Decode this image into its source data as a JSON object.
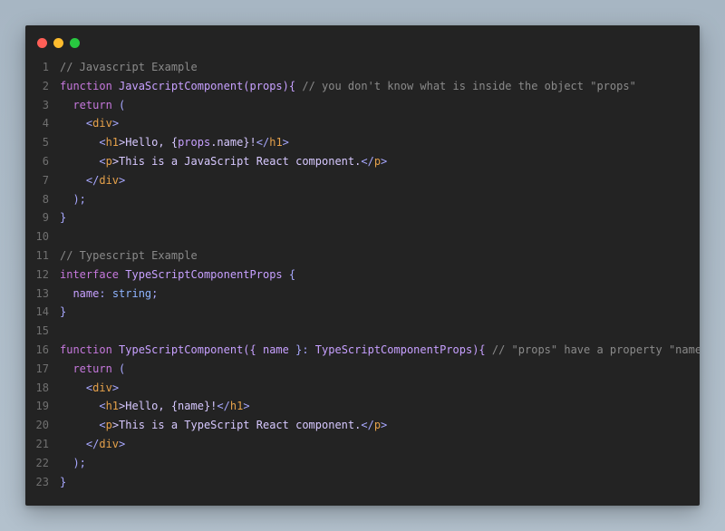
{
  "window": {
    "colors": {
      "background": "#232323",
      "traffic_red": "#ff5f57",
      "traffic_yellow": "#febc2e",
      "traffic_green": "#28c840"
    }
  },
  "code": {
    "line_numbers": [
      "1",
      "2",
      "3",
      "4",
      "5",
      "6",
      "7",
      "8",
      "9",
      "10",
      "11",
      "12",
      "13",
      "14",
      "15",
      "16",
      "17",
      "18",
      "19",
      "20",
      "21",
      "22",
      "23"
    ],
    "lines": [
      {
        "parts": [
          {
            "text": "// Javascript Example",
            "kind": "comment"
          }
        ]
      },
      {
        "parts": [
          {
            "text": "function",
            "kind": "kw"
          },
          {
            "text": " ",
            "kind": "plain"
          },
          {
            "text": "JavaScriptComponent(props){",
            "kind": "fn"
          },
          {
            "text": " ",
            "kind": "plain"
          },
          {
            "text": "// you don't know what is inside the object \"props\"",
            "kind": "comment"
          }
        ]
      },
      {
        "parts": [
          {
            "text": "  ",
            "kind": "plain"
          },
          {
            "text": "return",
            "kind": "kw"
          },
          {
            "text": " (",
            "kind": "punct"
          }
        ]
      },
      {
        "parts": [
          {
            "text": "    <",
            "kind": "punct"
          },
          {
            "text": "div",
            "kind": "tag"
          },
          {
            "text": ">",
            "kind": "punct"
          }
        ]
      },
      {
        "parts": [
          {
            "text": "      <",
            "kind": "punct"
          },
          {
            "text": "h1",
            "kind": "tag"
          },
          {
            "text": ">Hello, {",
            "kind": "jsx"
          },
          {
            "text": "props",
            "kind": "prop"
          },
          {
            "text": ".name}!",
            "kind": "jsx"
          },
          {
            "text": "</",
            "kind": "punct"
          },
          {
            "text": "h1",
            "kind": "tag"
          },
          {
            "text": ">",
            "kind": "punct"
          }
        ]
      },
      {
        "parts": [
          {
            "text": "      <",
            "kind": "punct"
          },
          {
            "text": "p",
            "kind": "tag"
          },
          {
            "text": ">This is a JavaScript React component.",
            "kind": "jsx"
          },
          {
            "text": "</",
            "kind": "punct"
          },
          {
            "text": "p",
            "kind": "tag"
          },
          {
            "text": ">",
            "kind": "punct"
          }
        ]
      },
      {
        "parts": [
          {
            "text": "    </",
            "kind": "punct"
          },
          {
            "text": "div",
            "kind": "tag"
          },
          {
            "text": ">",
            "kind": "punct"
          }
        ]
      },
      {
        "parts": [
          {
            "text": "  );",
            "kind": "punct"
          }
        ]
      },
      {
        "parts": [
          {
            "text": "}",
            "kind": "punct"
          }
        ]
      },
      {
        "parts": []
      },
      {
        "parts": [
          {
            "text": "// Typescript Example",
            "kind": "comment"
          }
        ]
      },
      {
        "parts": [
          {
            "text": "interface",
            "kind": "kw"
          },
          {
            "text": " ",
            "kind": "plain"
          },
          {
            "text": "TypeScriptComponentProps",
            "kind": "fn"
          },
          {
            "text": " {",
            "kind": "punct"
          }
        ]
      },
      {
        "parts": [
          {
            "text": "  ",
            "kind": "plain"
          },
          {
            "text": "name",
            "kind": "prop"
          },
          {
            "text": ": ",
            "kind": "punct"
          },
          {
            "text": "string",
            "kind": "type"
          },
          {
            "text": ";",
            "kind": "punct"
          }
        ]
      },
      {
        "parts": [
          {
            "text": "}",
            "kind": "punct"
          }
        ]
      },
      {
        "parts": []
      },
      {
        "parts": [
          {
            "text": "function",
            "kind": "kw"
          },
          {
            "text": " ",
            "kind": "plain"
          },
          {
            "text": "TypeScriptComponent({ ",
            "kind": "fn"
          },
          {
            "text": "name",
            "kind": "prop"
          },
          {
            "text": " }: ",
            "kind": "punct"
          },
          {
            "text": "TypeScriptComponentProps){",
            "kind": "fn"
          },
          {
            "text": " ",
            "kind": "plain"
          },
          {
            "text": "// \"props\" have a property \"name\"",
            "kind": "comment"
          }
        ]
      },
      {
        "parts": [
          {
            "text": "  ",
            "kind": "plain"
          },
          {
            "text": "return",
            "kind": "kw"
          },
          {
            "text": " (",
            "kind": "punct"
          }
        ]
      },
      {
        "parts": [
          {
            "text": "    <",
            "kind": "punct"
          },
          {
            "text": "div",
            "kind": "tag"
          },
          {
            "text": ">",
            "kind": "punct"
          }
        ]
      },
      {
        "parts": [
          {
            "text": "      <",
            "kind": "punct"
          },
          {
            "text": "h1",
            "kind": "tag"
          },
          {
            "text": ">Hello, {name}!",
            "kind": "jsx"
          },
          {
            "text": "</",
            "kind": "punct"
          },
          {
            "text": "h1",
            "kind": "tag"
          },
          {
            "text": ">",
            "kind": "punct"
          }
        ]
      },
      {
        "parts": [
          {
            "text": "      <",
            "kind": "punct"
          },
          {
            "text": "p",
            "kind": "tag"
          },
          {
            "text": ">This is a TypeScript React component.",
            "kind": "jsx"
          },
          {
            "text": "</",
            "kind": "punct"
          },
          {
            "text": "p",
            "kind": "tag"
          },
          {
            "text": ">",
            "kind": "punct"
          }
        ]
      },
      {
        "parts": [
          {
            "text": "    </",
            "kind": "punct"
          },
          {
            "text": "div",
            "kind": "tag"
          },
          {
            "text": ">",
            "kind": "punct"
          }
        ]
      },
      {
        "parts": [
          {
            "text": "  );",
            "kind": "punct"
          }
        ]
      },
      {
        "parts": [
          {
            "text": "}",
            "kind": "punct"
          }
        ]
      }
    ]
  }
}
